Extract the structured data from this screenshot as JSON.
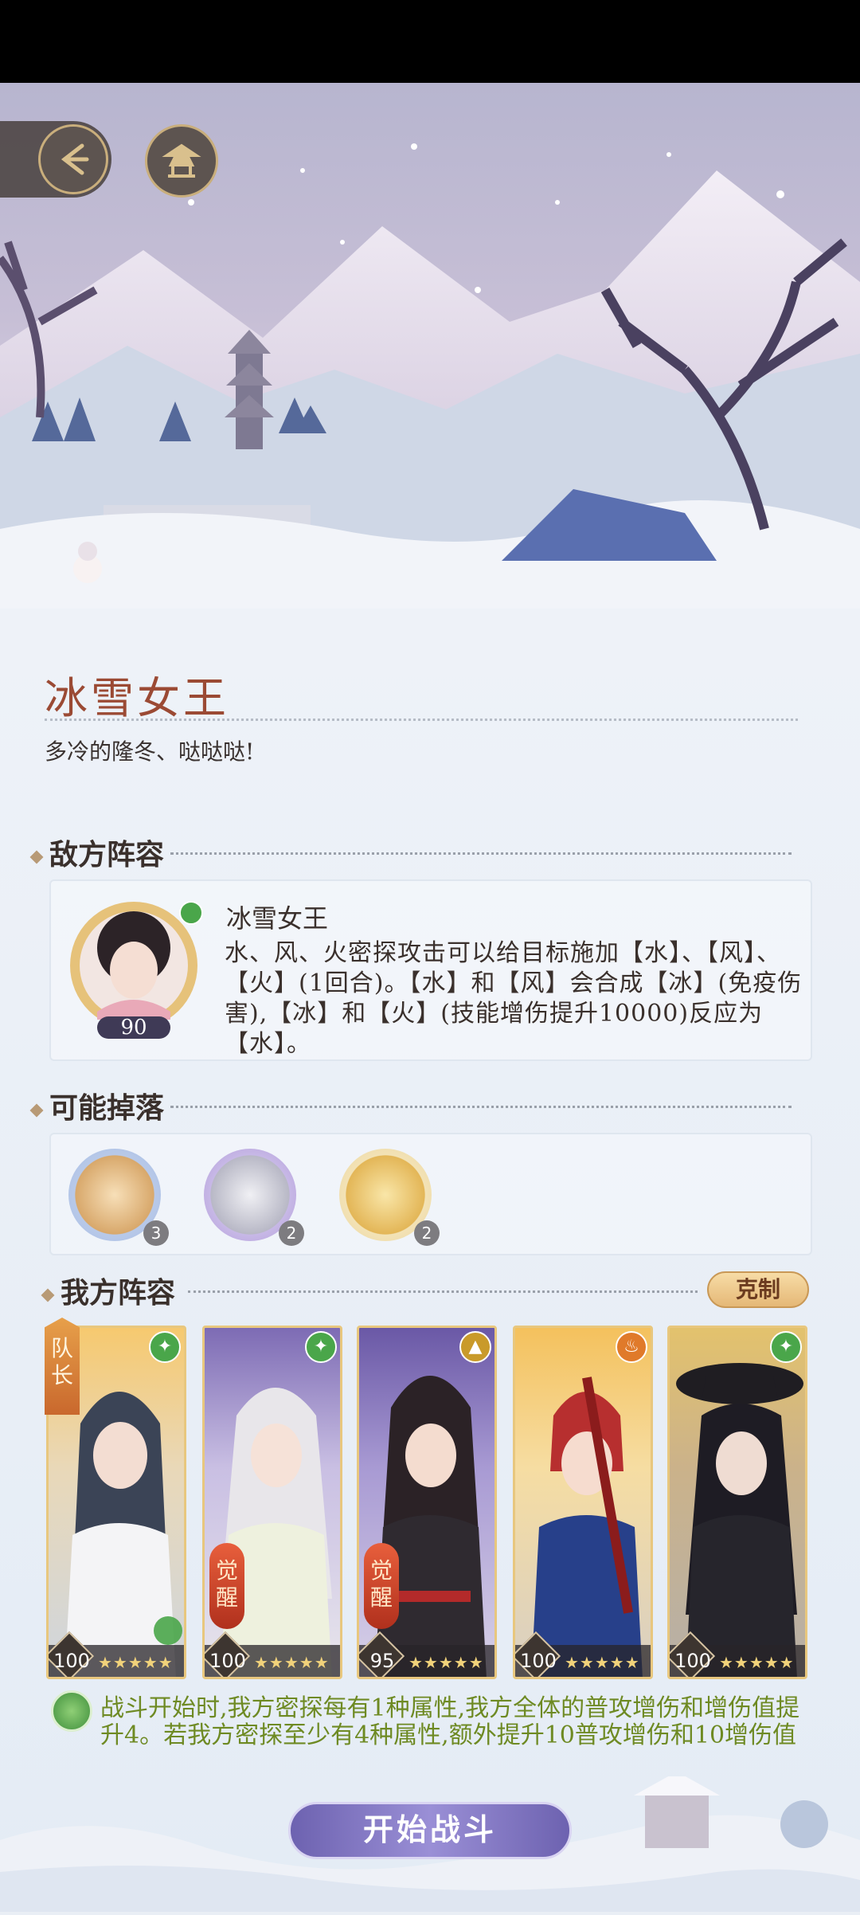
{
  "stage": {
    "title": "冰雪女王",
    "subtitle": "多冷的隆冬、哒哒哒!"
  },
  "enemy_section": {
    "heading": "敌方阵容",
    "enemy": {
      "name": "冰雪女王",
      "level": "90",
      "description": "水、风、火密探攻击可以给目标施加【水】、【风】、【火】(1回合)。【水】和【风】会合成【冰】(免疫伤害),【冰】和【火】(技能增伤提升10000)反应为【水】。"
    }
  },
  "drops_section": {
    "heading": "可能掉落",
    "items": [
      {
        "icon": "bronze-chest-icon",
        "count": "3"
      },
      {
        "icon": "silver-chest-icon",
        "count": "2"
      },
      {
        "icon": "gold-chest-icon",
        "count": "2"
      }
    ]
  },
  "team_section": {
    "heading": "我方阵容",
    "counter_button": "克制",
    "captain_label": "队长",
    "awaken_label": "觉醒",
    "members": [
      {
        "level": "100",
        "attribute": "wind",
        "stars": "★★★★★"
      },
      {
        "level": "100",
        "attribute": "wind",
        "stars": "★★★★★"
      },
      {
        "level": "95",
        "attribute": "earth",
        "stars": "★★★★★"
      },
      {
        "level": "100",
        "attribute": "fire",
        "stars": "★★★★★"
      },
      {
        "level": "100",
        "attribute": "wind",
        "stars": "★★★★★"
      }
    ],
    "bonus_text": "战斗开始时,我方密探每有1种属性,我方全体的普攻增伤和增伤值提升4。若我方密探至少有4种属性,额外提升10普攻增伤和10增伤值"
  },
  "start_button": "开始战斗",
  "colors": {
    "title": "#9b4a34",
    "bonus": "#6e8a23",
    "wind": "#4aa64a",
    "fire": "#e07a2a",
    "earth": "#c99a2a"
  }
}
